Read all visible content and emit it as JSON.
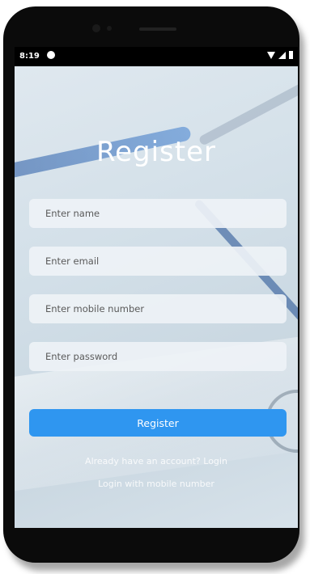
{
  "status_bar": {
    "time": "8:19"
  },
  "register_form": {
    "title": "Register",
    "name_placeholder": "Enter name",
    "email_placeholder": "Enter email",
    "mobile_placeholder": "Enter mobile number",
    "password_placeholder": "Enter password",
    "register_button": "Register",
    "login_link": "Already have an account? Login",
    "mobile_login_link": "Login with mobile number"
  },
  "colors": {
    "primary_button": "#2f96f0",
    "title_text": "#ffffff"
  },
  "nav_bar": {
    "icons": [
      "back-icon",
      "home-icon",
      "recents-icon"
    ]
  }
}
